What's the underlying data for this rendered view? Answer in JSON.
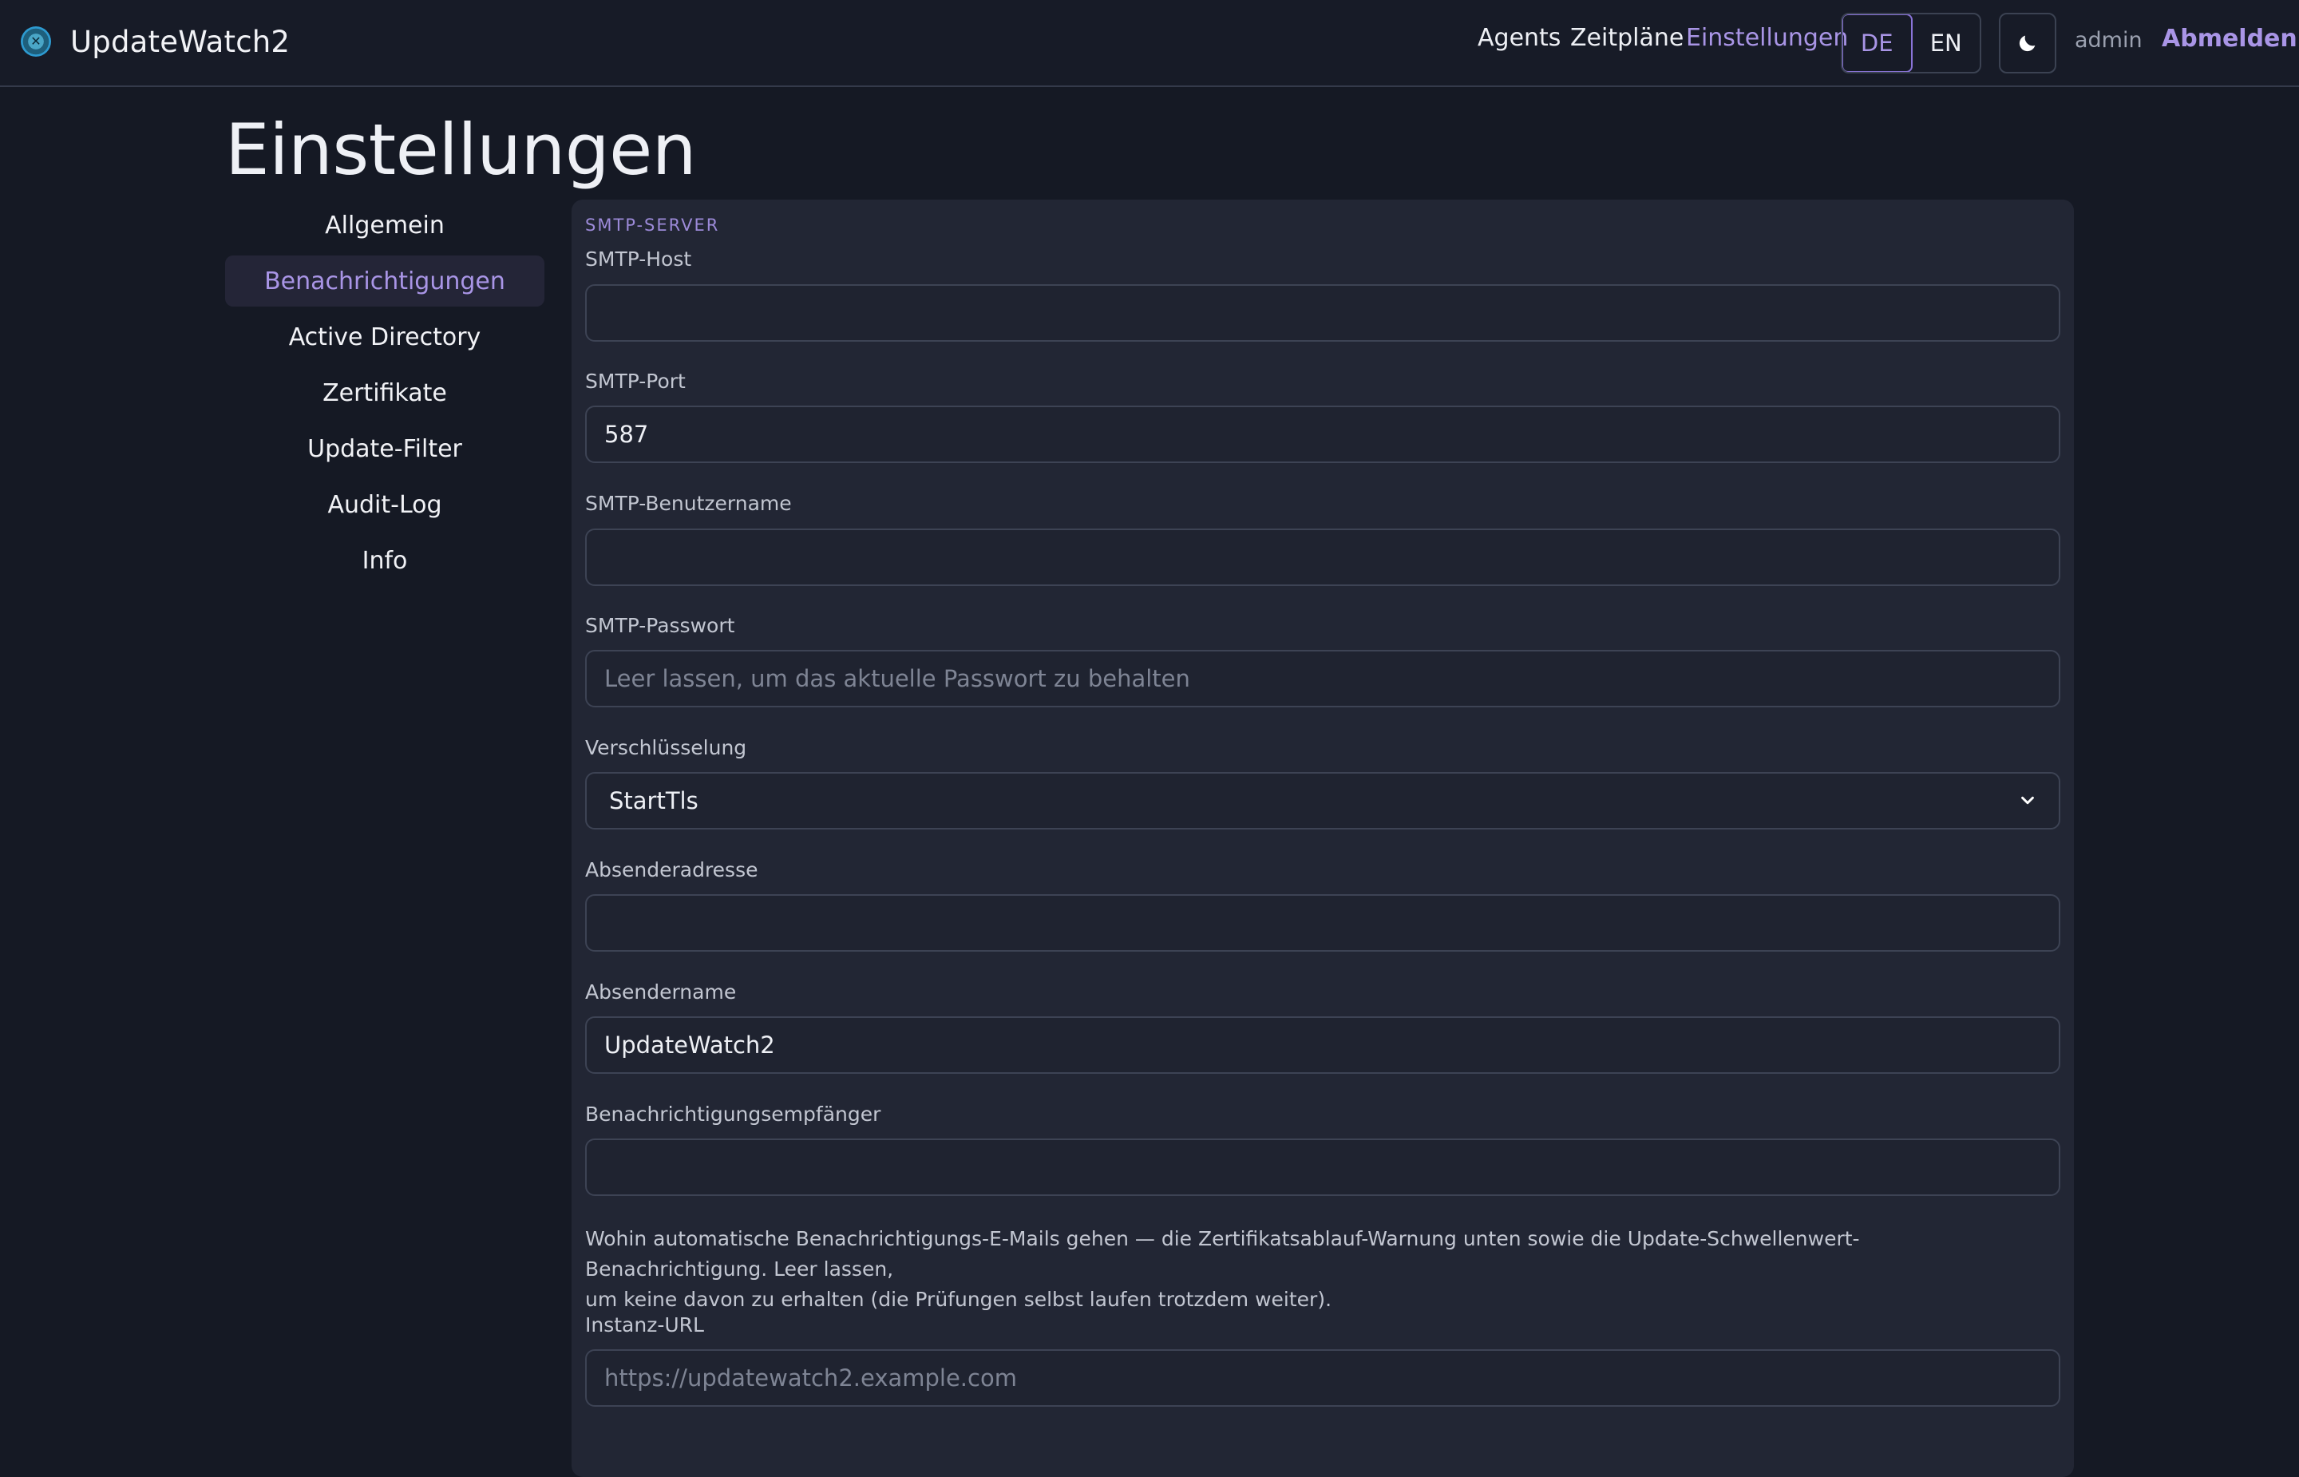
{
  "header": {
    "app_title": "UpdateWatch2",
    "nav": [
      {
        "label": "Agents"
      },
      {
        "label": "Zeitpläne"
      },
      {
        "label": "Einstellungen",
        "active": true
      }
    ],
    "languages": [
      {
        "label": "DE",
        "active": true
      },
      {
        "label": "EN",
        "active": false
      }
    ],
    "theme_icon": "moon-icon",
    "user": "admin",
    "logout_label": "Abmelden"
  },
  "page": {
    "title": "Einstellungen"
  },
  "sidebar": {
    "items": [
      {
        "label": "Allgemein"
      },
      {
        "label": "Benachrichtigungen",
        "active": true
      },
      {
        "label": "Active Directory"
      },
      {
        "label": "Zertifikate"
      },
      {
        "label": "Update-Filter"
      },
      {
        "label": "Audit-Log"
      },
      {
        "label": "Info"
      }
    ]
  },
  "form": {
    "section_title": "SMTP-SERVER",
    "smtp_host": {
      "label": "SMTP-Host",
      "value": "",
      "placeholder": ""
    },
    "smtp_port": {
      "label": "SMTP-Port",
      "value": "587",
      "placeholder": ""
    },
    "smtp_username": {
      "label": "SMTP-Benutzername",
      "value": "",
      "placeholder": ""
    },
    "smtp_password": {
      "label": "SMTP-Passwort",
      "value": "",
      "placeholder": "Leer lassen, um das aktuelle Passwort zu behalten"
    },
    "encryption": {
      "label": "Verschlüsselung",
      "selected": "StartTls"
    },
    "sender_address": {
      "label": "Absenderadresse",
      "value": "",
      "placeholder": ""
    },
    "sender_name": {
      "label": "Absendername",
      "value": "UpdateWatch2",
      "placeholder": ""
    },
    "recipients": {
      "label": "Benachrichtigungsempfänger",
      "value": "",
      "placeholder": ""
    },
    "recipients_help_line1": "Wohin automatische Benachrichtigungs-E-Mails gehen — die Zertifikatsablauf-Warnung unten sowie die Update-Schwellenwert-Benachrichtigung. Leer lassen,",
    "recipients_help_line2": "um keine davon zu erhalten (die Prüfungen selbst laufen trotzdem weiter).",
    "instance_url": {
      "label": "Instanz-URL",
      "value": "",
      "placeholder": "https://updatewatch2.example.com"
    }
  },
  "colors": {
    "background": "#151924",
    "panel": "#222634",
    "accent": "#a995e6",
    "text": "#eef0f5"
  }
}
